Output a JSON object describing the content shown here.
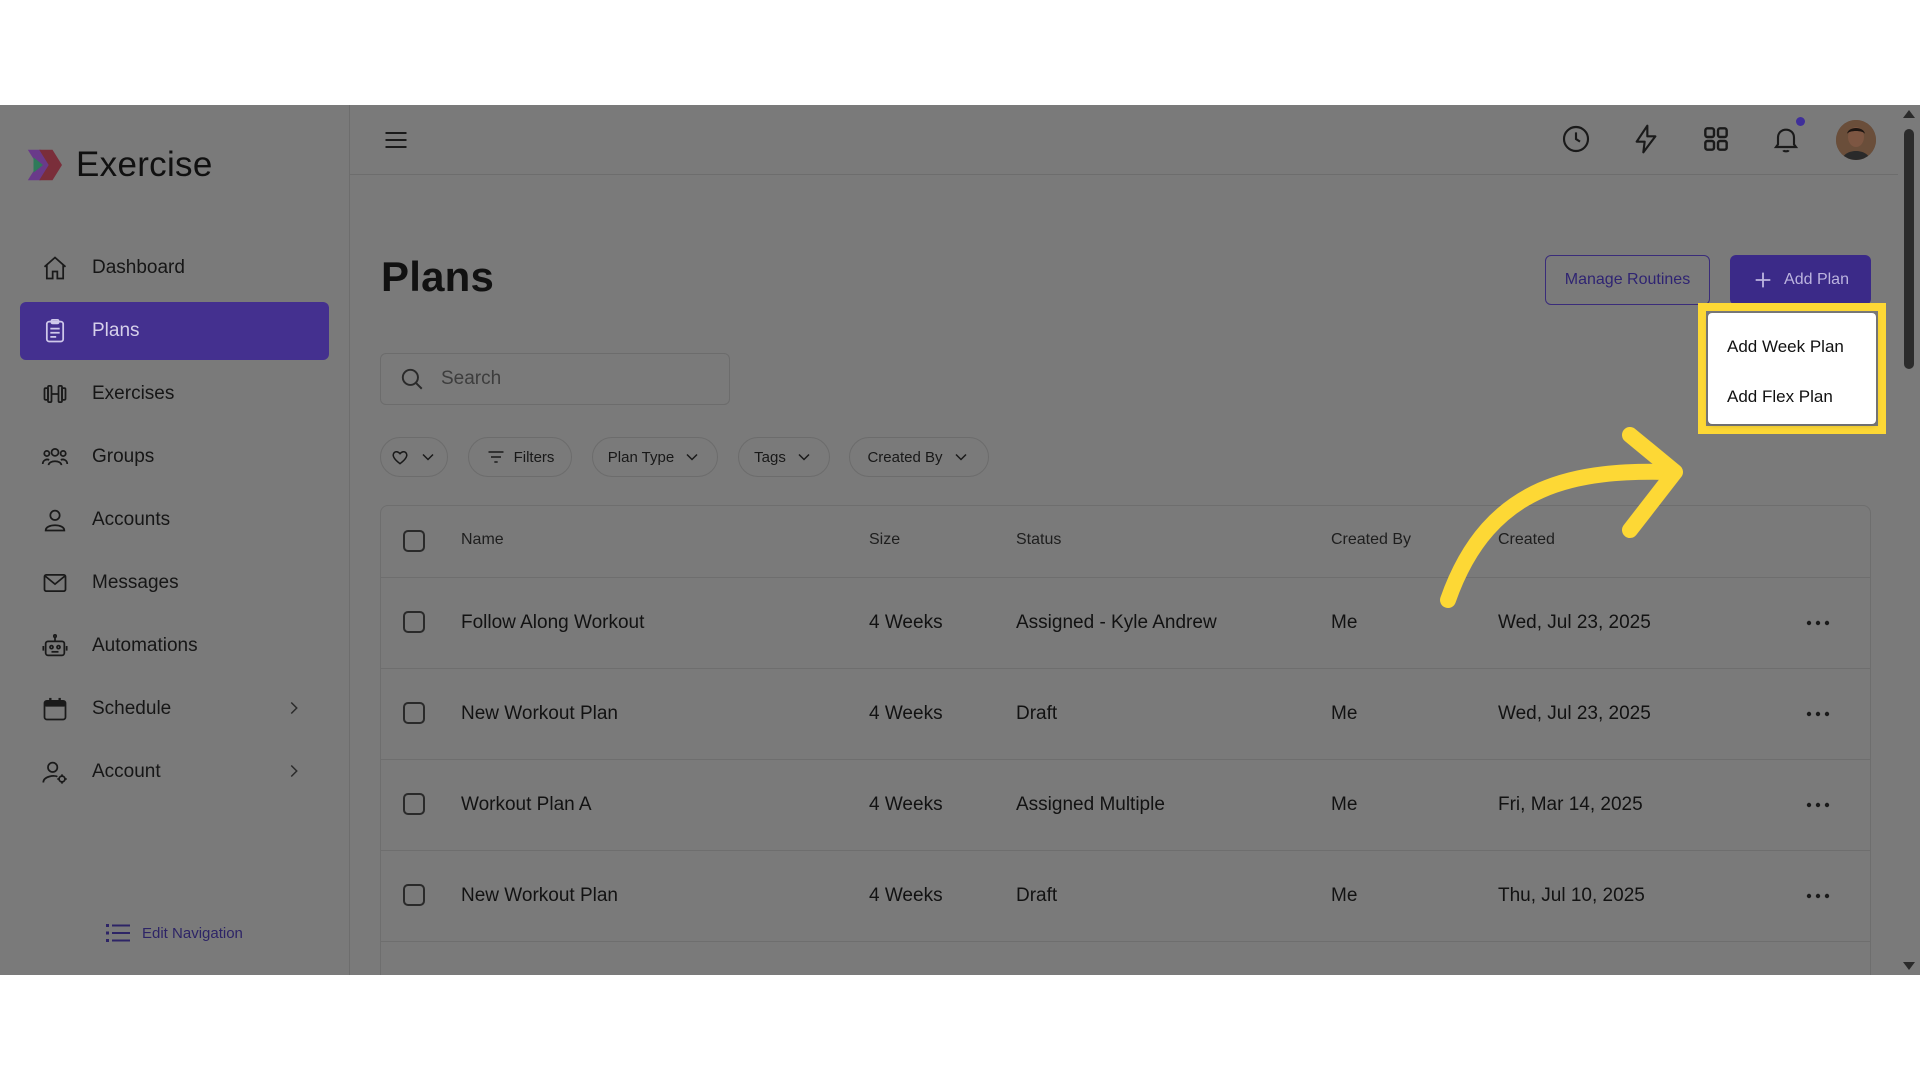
{
  "app": {
    "brand_name": "Exercise",
    "accent_color": "#44308f",
    "highlight_color": "#fdd835"
  },
  "sidebar": {
    "items": [
      {
        "label": "Dashboard",
        "icon": "home-icon"
      },
      {
        "label": "Plans",
        "icon": "clipboard-icon",
        "active": true
      },
      {
        "label": "Exercises",
        "icon": "dumbbell-icon"
      },
      {
        "label": "Groups",
        "icon": "users-icon"
      },
      {
        "label": "Accounts",
        "icon": "user-icon"
      },
      {
        "label": "Messages",
        "icon": "mail-icon"
      },
      {
        "label": "Automations",
        "icon": "robot-icon"
      },
      {
        "label": "Schedule",
        "icon": "calendar-icon",
        "expandable": true
      },
      {
        "label": "Account",
        "icon": "user-gear-icon",
        "expandable": true
      }
    ],
    "edit_navigation": "Edit Navigation"
  },
  "topbar": {
    "icons": [
      "menu-icon",
      "history-icon",
      "bolt-icon",
      "apps-grid-icon",
      "bell-icon",
      "avatar"
    ]
  },
  "page": {
    "title": "Plans",
    "manage_routines": "Manage Routines",
    "add_plan": "Add Plan",
    "search_placeholder": "Search"
  },
  "filters": {
    "filters_label": "Filters",
    "plan_type": "Plan Type",
    "tags": "Tags",
    "created_by": "Created By"
  },
  "dropdown": {
    "items": [
      "Add Week Plan",
      "Add Flex Plan"
    ]
  },
  "table": {
    "columns": [
      "Name",
      "Size",
      "Status",
      "Created By",
      "Created"
    ],
    "rows": [
      {
        "name": "Follow Along Workout",
        "size": "4 Weeks",
        "status": "Assigned - Kyle Andrew",
        "created_by": "Me",
        "created": "Wed, Jul 23, 2025"
      },
      {
        "name": "New Workout Plan",
        "size": "4 Weeks",
        "status": "Draft",
        "created_by": "Me",
        "created": "Wed, Jul 23, 2025"
      },
      {
        "name": "Workout Plan A",
        "size": "4 Weeks",
        "status": "Assigned Multiple",
        "created_by": "Me",
        "created": "Fri, Mar 14, 2025"
      },
      {
        "name": "New Workout Plan",
        "size": "4 Weeks",
        "status": "Draft",
        "created_by": "Me",
        "created": "Thu, Jul 10, 2025"
      }
    ]
  }
}
